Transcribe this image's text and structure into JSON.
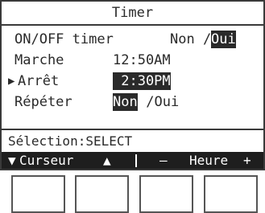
{
  "screen": {
    "title": "Timer",
    "rows": [
      {
        "label": "ON/OFF timer",
        "option_non": "Non /",
        "option_oui": "Oui"
      },
      {
        "label": "Marche",
        "value": "12:50AM"
      },
      {
        "cursor": "▶",
        "label": "Arrêt",
        "value": " 2:30PM"
      },
      {
        "label": "Répéter",
        "option_non": "Non",
        "option_oui": " /Oui"
      }
    ],
    "status": "Sélection:SELECT",
    "softkeys": {
      "cursor_down": "▼",
      "cursor_label": "Curseur",
      "cursor_up": "▲",
      "minus": "—",
      "heure": "Heure",
      "plus": "+"
    }
  },
  "colors": {
    "lcd_text": "#2a2a2a",
    "lcd_background": "#ffffff",
    "softkey_bar": "#1e1e1e"
  }
}
